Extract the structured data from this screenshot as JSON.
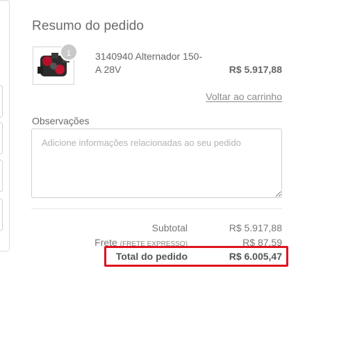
{
  "summary": {
    "title": "Resumo do pedido"
  },
  "product": {
    "image_icon": "alternator-product-image",
    "quantity": "1",
    "name": "3140940 Alternador 150-A 28V",
    "price": "R$ 5.917,88"
  },
  "back_link": "Voltar ao carrinho",
  "notes": {
    "label": "Observações",
    "placeholder": "Adicione informações relacionadas ao seu pedido",
    "value": ""
  },
  "totals": {
    "subtotal_label": "Subtotal",
    "subtotal_value": "R$ 5.917,88",
    "frete_label": "Frete",
    "frete_method": "(FRETE EXPRESSO)",
    "frete_value": "R$ 87,59",
    "total_label": "Total do pedido",
    "total_value": "R$ 6.005,47"
  },
  "colors": {
    "highlight": "#e0131f",
    "badge": "#c9c9c9"
  }
}
